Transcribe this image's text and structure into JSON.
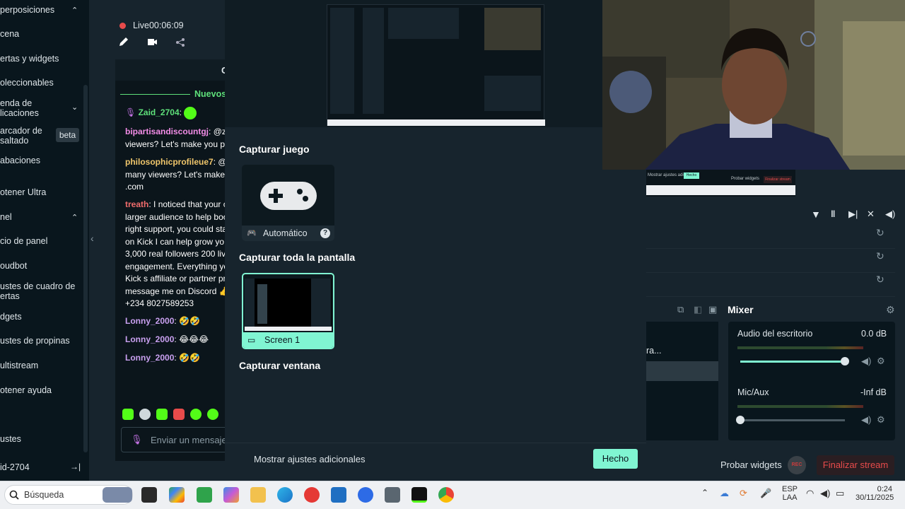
{
  "sidebar": {
    "items": [
      {
        "label": "perposiciones"
      },
      {
        "label": "cena"
      },
      {
        "label": "ertas y widgets"
      },
      {
        "label": "oleccionables"
      },
      {
        "label": "enda de",
        "label2": "licaciones"
      },
      {
        "label": "arcador de",
        "label2": "saltado"
      },
      {
        "label": "abaciones"
      },
      {
        "label": "otener Ultra"
      },
      {
        "label": "nel"
      },
      {
        "label": "cio de panel"
      },
      {
        "label": "oudbot"
      },
      {
        "label": "ustes de cuadro de",
        "label2": "ertas"
      },
      {
        "label": "dgets"
      },
      {
        "label": "ustes de propinas"
      },
      {
        "label": "ultistream"
      },
      {
        "label": "otener ayuda"
      },
      {
        "label": "ustes"
      },
      {
        "label": "id-2704"
      }
    ],
    "beta_label": "beta",
    "chevron": "⌃",
    "chevron_down": "⌄",
    "logout_icon": "→|"
  },
  "stream": {
    "live_label": "Live",
    "live_time": "00:06:09"
  },
  "chat": {
    "header_letter": "C",
    "new_label": "Nuevos",
    "messages": [
      {
        "user": "Zaid_2704",
        "suffix": ":",
        "text": ""
      },
      {
        "user": "bipartisandiscountgj",
        "suffix": ":",
        "text": "@za",
        "cont": [
          "viewers? Let's make you po"
        ]
      },
      {
        "user": "philosophicprofileue7",
        "suffix": ":",
        "text": "@z",
        "cont": [
          "many viewers? Let's make",
          ".com"
        ]
      },
      {
        "user": "treath",
        "suffix": ":",
        "text": "I noticed that your c",
        "cont": [
          "larger audience to help boo",
          "right support, you could sta",
          "on Kick I can help grow yo",
          "3,000 real followers 200 liv",
          "engagement. Everything yo",
          "Kick s affiliate or partner pr",
          "message me on Discord 👍",
          "+234 8027589253"
        ]
      },
      {
        "user": "Lonny_2000",
        "suffix": ":",
        "text": "🤣🤣"
      },
      {
        "user": "Lonny_2000",
        "suffix": ":",
        "text": "😂😂😂"
      },
      {
        "user": "Lonny_2000",
        "suffix": ":",
        "text": "🤣🤣"
      }
    ],
    "input_placeholder": "Enviar un mensaje"
  },
  "modal": {
    "sections": {
      "game": "Capturar juego",
      "screen": "Capturar toda la pantalla",
      "window": "Capturar ventana"
    },
    "game_card_label": "Automático",
    "screen_card_label": "Screen 1",
    "more_settings": "Mostrar ajustes adicionales",
    "done": "Hecho"
  },
  "mini_preview": {
    "text1": "Mostrar ajustes adicionales",
    "btn": "Hecho",
    "text2": "Probar widgets",
    "btn2": "Finalizar stream"
  },
  "scenes": {
    "partial_label": "ra..."
  },
  "mixer": {
    "title": "Mixer",
    "channels": [
      {
        "name": "Audio del escritorio",
        "db": "0.0 dB",
        "level": 1.0
      },
      {
        "name": "Mic/Aux",
        "db": "-Inf dB",
        "level": 0.0
      }
    ]
  },
  "footer": {
    "test_widgets": "Probar widgets",
    "rec": "REC",
    "end_stream": "Finalizar stream"
  },
  "taskbar": {
    "search_placeholder": "Búsqueda",
    "lang_line1": "ESP",
    "lang_line2": "LAA",
    "time": "0:24",
    "date": "30/11/2025"
  },
  "colors": {
    "accent": "#80f5d2",
    "live_red": "#e84b4b",
    "bg_dark": "#09161d",
    "bg_panel": "#17242d"
  }
}
